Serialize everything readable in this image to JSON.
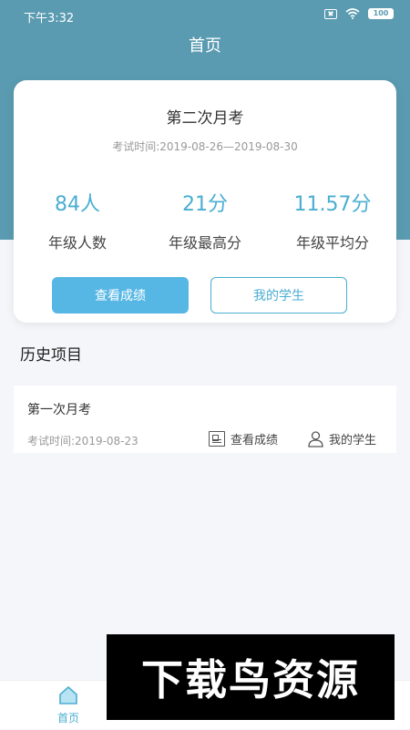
{
  "status_bar": {
    "time": "下午3:32",
    "battery": "100"
  },
  "header": {
    "title": "首页"
  },
  "current_exam": {
    "name": "第二次月考",
    "time": "考试时间:2019-08-26—2019-08-30",
    "stats": [
      {
        "value": "84人",
        "label": "年级人数"
      },
      {
        "value": "21分",
        "label": "年级最高分"
      },
      {
        "value": "11.57分",
        "label": "年级平均分"
      }
    ],
    "view_scores_label": "查看成绩",
    "my_students_label": "我的学生"
  },
  "history": {
    "title": "历史项目",
    "items": [
      {
        "name": "第一次月考",
        "time": "考试时间:2019-08-23",
        "view_scores_label": "查看成绩",
        "my_students_label": "我的学生"
      }
    ]
  },
  "bottom_nav": {
    "items": [
      {
        "label": "首页",
        "icon": "home-icon"
      },
      {
        "label": "",
        "icon": "document-icon"
      },
      {
        "label": "",
        "icon": "user-icon"
      }
    ]
  },
  "watermark": {
    "text": "下载鸟资源"
  },
  "colors": {
    "accent": "#4aaed2",
    "header": "#5a9bb1",
    "button": "#57b7e4"
  }
}
